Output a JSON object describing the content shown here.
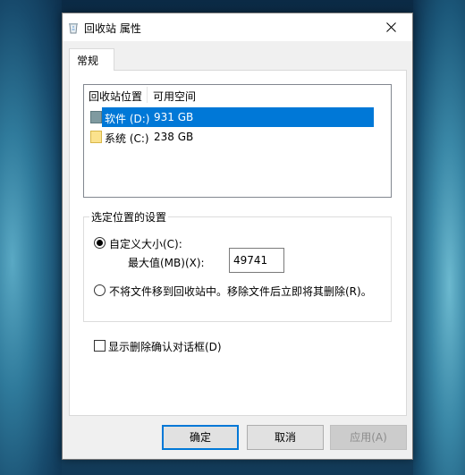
{
  "window": {
    "title": "回收站 属性",
    "icon": "recycle-bin-icon"
  },
  "tabs": [
    {
      "label": "常规",
      "active": true
    }
  ],
  "list": {
    "columns": [
      "回收站位置",
      "可用空间"
    ],
    "rows": [
      {
        "name": "软件 (D:)",
        "space": "931 GB",
        "selected": true,
        "icon": "drive-icon",
        "color": "#7f9aa0"
      },
      {
        "name": "系统 (C:)",
        "space": "238 GB",
        "selected": false,
        "icon": "folder-icon",
        "color": "#fbe28d"
      }
    ]
  },
  "settings": {
    "group_label": "选定位置的设置",
    "custom_size_label": "自定义大小(C):",
    "custom_size_checked": true,
    "max_label": "最大值(MB)(X):",
    "max_value": "49741",
    "no_move_label": "不将文件移到回收站中。移除文件后立即将其删除(R)。",
    "no_move_checked": false
  },
  "confirm": {
    "label": "显示删除确认对话框(D)",
    "checked": false
  },
  "buttons": {
    "ok": "确定",
    "cancel": "取消",
    "apply": "应用(A)"
  },
  "colors": {
    "selection": "#0078d7",
    "accent": "#0078d7"
  }
}
